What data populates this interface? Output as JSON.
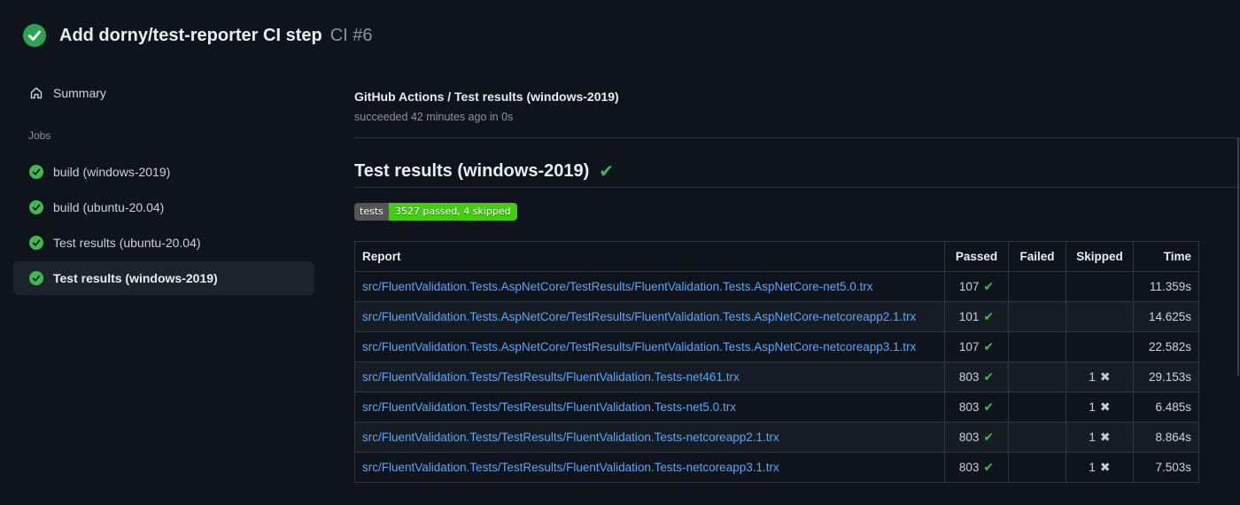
{
  "window": {
    "title": "Add dorny/test-reporter CI step",
    "run_number": "CI #6"
  },
  "sidebar": {
    "summary_label": "Summary",
    "jobs_section_label": "Jobs",
    "jobs": [
      {
        "label": "build (windows-2019)",
        "status": "success",
        "selected": false
      },
      {
        "label": "build (ubuntu-20.04)",
        "status": "success",
        "selected": false
      },
      {
        "label": "Test results (ubuntu-20.04)",
        "status": "success",
        "selected": false
      },
      {
        "label": "Test results (windows-2019)",
        "status": "success",
        "selected": true
      }
    ]
  },
  "main": {
    "check_title": "GitHub Actions / Test results (windows-2019)",
    "check_status_line": "succeeded 42 minutes ago in 0s",
    "report_heading": "Test results (windows-2019)",
    "report_heading_icon": "✔",
    "badge": {
      "label": "tests",
      "value": "3527 passed, 4 skipped",
      "label_bg": "#555555",
      "value_bg": "#44cc11"
    },
    "table": {
      "columns": [
        "Report",
        "Passed",
        "Failed",
        "Skipped",
        "Time"
      ],
      "rows": [
        {
          "report": "src/FluentValidation.Tests.AspNetCore/TestResults/FluentValidation.Tests.AspNetCore-net5.0.trx",
          "passed": "107",
          "passed_icon": "✔",
          "failed": "",
          "skipped": "",
          "skipped_icon": "",
          "time": "11.359s"
        },
        {
          "report": "src/FluentValidation.Tests.AspNetCore/TestResults/FluentValidation.Tests.AspNetCore-netcoreapp2.1.trx",
          "passed": "101",
          "passed_icon": "✔",
          "failed": "",
          "skipped": "",
          "skipped_icon": "",
          "time": "14.625s"
        },
        {
          "report": "src/FluentValidation.Tests.AspNetCore/TestResults/FluentValidation.Tests.AspNetCore-netcoreapp3.1.trx",
          "passed": "107",
          "passed_icon": "✔",
          "failed": "",
          "skipped": "",
          "skipped_icon": "",
          "time": "22.582s"
        },
        {
          "report": "src/FluentValidation.Tests/TestResults/FluentValidation.Tests-net461.trx",
          "passed": "803",
          "passed_icon": "✔",
          "failed": "",
          "skipped": "1",
          "skipped_icon": "✖",
          "time": "29.153s"
        },
        {
          "report": "src/FluentValidation.Tests/TestResults/FluentValidation.Tests-net5.0.trx",
          "passed": "803",
          "passed_icon": "✔",
          "failed": "",
          "skipped": "1",
          "skipped_icon": "✖",
          "time": "6.485s"
        },
        {
          "report": "src/FluentValidation.Tests/TestResults/FluentValidation.Tests-netcoreapp2.1.trx",
          "passed": "803",
          "passed_icon": "✔",
          "failed": "",
          "skipped": "1",
          "skipped_icon": "✖",
          "time": "8.864s"
        },
        {
          "report": "src/FluentValidation.Tests/TestResults/FluentValidation.Tests-netcoreapp3.1.trx",
          "passed": "803",
          "passed_icon": "✔",
          "failed": "",
          "skipped": "1",
          "skipped_icon": "✖",
          "time": "7.503s"
        }
      ]
    }
  },
  "colors": {
    "success_green": "#3fb950",
    "link_blue": "#58a6ff",
    "badge_label_bg": "#555555",
    "badge_value_bg": "#44cc11",
    "selected_item_bg": "#1d232c"
  }
}
